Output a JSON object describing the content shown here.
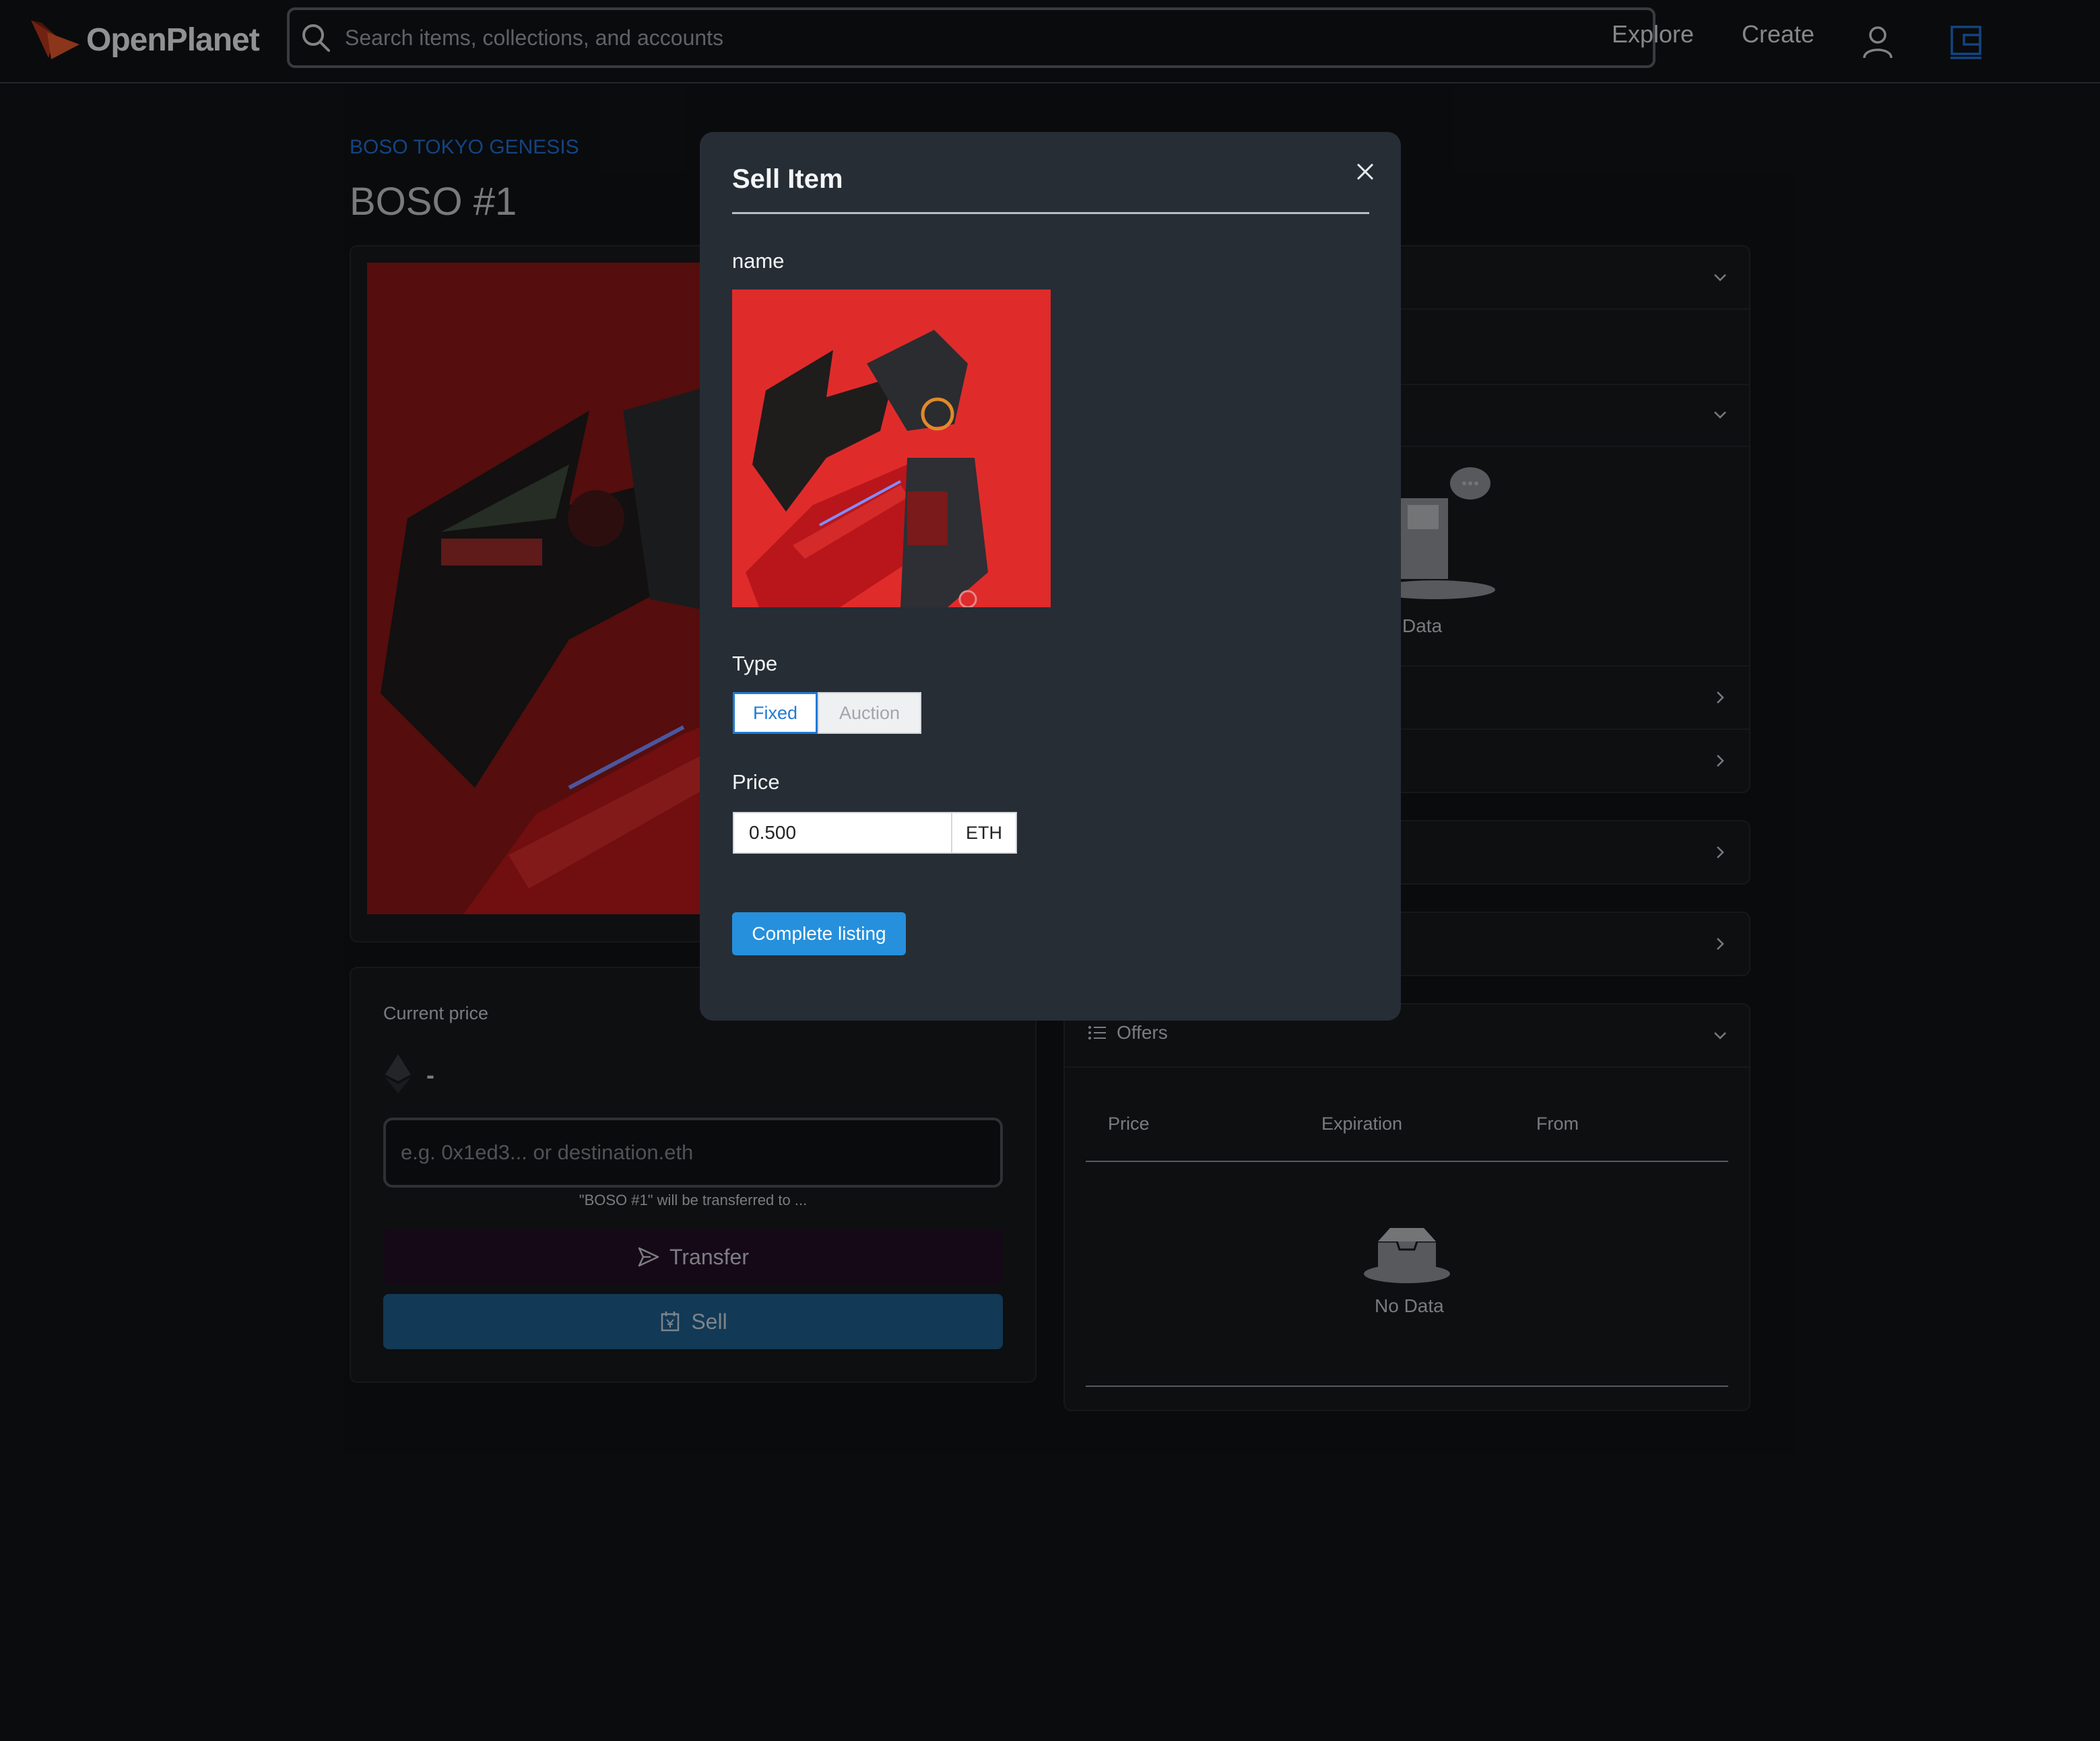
{
  "header": {
    "logo_text": "OpenPlanet",
    "search_placeholder": "Search items, collections, and accounts",
    "nav": {
      "explore": "Explore",
      "create": "Create"
    }
  },
  "item": {
    "collection": "BOSO TOKYO GENESIS",
    "title": "BOSO #1"
  },
  "price_panel": {
    "current_price_label": "Current price",
    "current_price_value": "-",
    "address_placeholder": "e.g. 0x1ed3... or destination.eth",
    "transfer_note": "\"BOSO #1\" will be transferred to ...",
    "transfer_label": "Transfer",
    "sell_label": "Sell"
  },
  "details": {
    "no_data_partial": "Data"
  },
  "offers": {
    "title": "Offers",
    "columns": [
      "Price",
      "Expiration",
      "From"
    ],
    "empty_text": "No Data"
  },
  "modal": {
    "title": "Sell Item",
    "name_label": "name",
    "type_label": "Type",
    "type_options": [
      "Fixed",
      "Auction"
    ],
    "selected_type": "Fixed",
    "price_label": "Price",
    "price_value": "0.500",
    "price_unit": "ETH",
    "submit_label": "Complete listing"
  },
  "colors": {
    "background": "#111315",
    "accent": "#2690dc",
    "link": "#1f6fd1",
    "modal_bg": "#262d35",
    "sell_button": "#1d5c8a",
    "transfer_button": "#221028"
  }
}
